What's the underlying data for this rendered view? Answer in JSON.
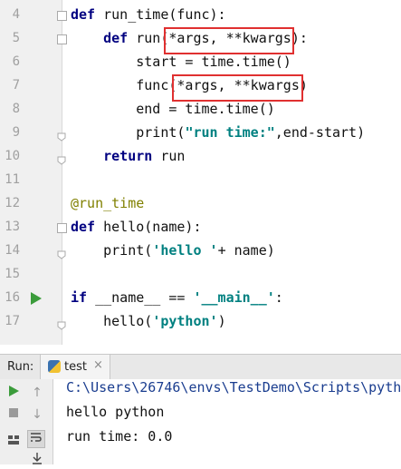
{
  "editor": {
    "lines": [
      {
        "n": "4",
        "tokens": [
          {
            "t": "def",
            "c": "kw"
          },
          {
            "t": " run_time(func):"
          }
        ]
      },
      {
        "n": "5",
        "tokens": [
          {
            "t": "    "
          },
          {
            "t": "def",
            "c": "kw"
          },
          {
            "t": " run(*args, **kwargs):"
          }
        ]
      },
      {
        "n": "6",
        "tokens": [
          {
            "t": "        start = time.time()"
          }
        ]
      },
      {
        "n": "7",
        "tokens": [
          {
            "t": "        func(*args, **kwargs)"
          }
        ]
      },
      {
        "n": "8",
        "tokens": [
          {
            "t": "        end = time.time()"
          }
        ]
      },
      {
        "n": "9",
        "tokens": [
          {
            "t": "        print("
          },
          {
            "t": "\"run time:\"",
            "c": "str"
          },
          {
            "t": ",end-start)"
          }
        ]
      },
      {
        "n": "10",
        "tokens": [
          {
            "t": "    "
          },
          {
            "t": "return",
            "c": "kw"
          },
          {
            "t": " run"
          }
        ]
      },
      {
        "n": "11",
        "tokens": []
      },
      {
        "n": "12",
        "tokens": [
          {
            "t": "@run_time",
            "c": "dec"
          }
        ]
      },
      {
        "n": "13",
        "tokens": [
          {
            "t": "def",
            "c": "kw"
          },
          {
            "t": " hello(name):"
          }
        ]
      },
      {
        "n": "14",
        "tokens": [
          {
            "t": "    print("
          },
          {
            "t": "'hello '",
            "c": "str"
          },
          {
            "t": "+ name)"
          }
        ]
      },
      {
        "n": "15",
        "tokens": []
      },
      {
        "n": "16",
        "tokens": [
          {
            "t": "if",
            "c": "kw"
          },
          {
            "t": " __name__ == "
          },
          {
            "t": "'__main__'",
            "c": "str"
          },
          {
            "t": ":"
          }
        ]
      },
      {
        "n": "17",
        "tokens": [
          {
            "t": "    hello("
          },
          {
            "t": "'python'",
            "c": "str"
          },
          {
            "t": ")"
          }
        ]
      }
    ]
  },
  "run_panel": {
    "label": "Run:",
    "tab_name": "test",
    "tab_close": "×",
    "output": [
      "C:\\Users\\26746\\envs\\TestDemo\\Scripts\\pyth",
      "hello python",
      "run time: 0.0"
    ]
  },
  "colors": {
    "keyword": "#000080",
    "string": "#008080",
    "decorator": "#808000",
    "highlight_box": "#e03030",
    "run_green": "#3b9c3b"
  }
}
